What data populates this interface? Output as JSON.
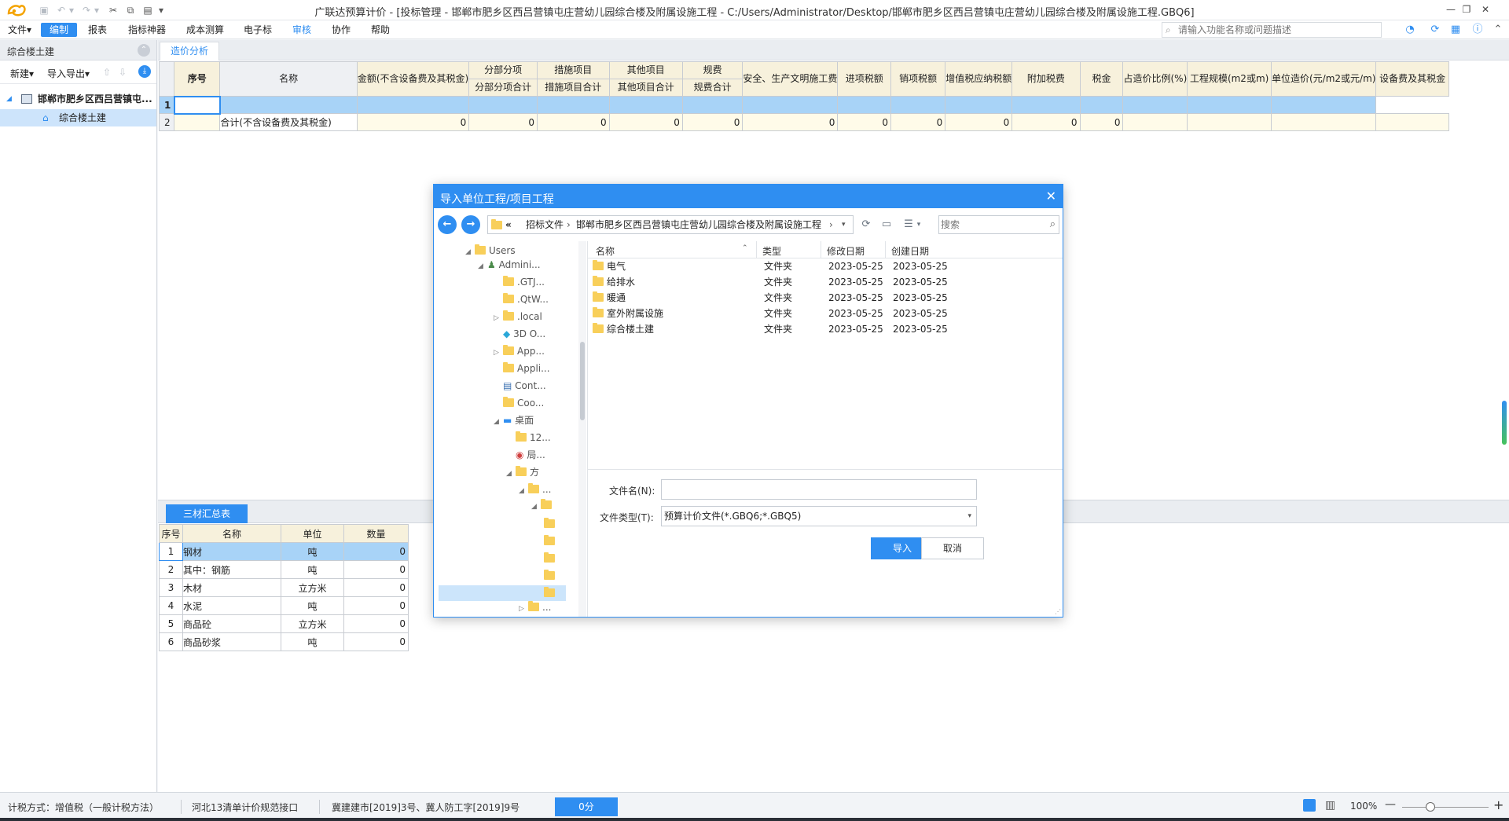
{
  "window": {
    "title": "广联达预算计价 - [投标管理 - 邯郸市肥乡区西吕营镇屯庄营幼儿园综合楼及附属设施工程 - C:/Users/Administrator/Desktop/邯郸市肥乡区西吕营镇屯庄营幼儿园综合楼及附属设施工程.GBQ6]"
  },
  "menu": {
    "items": [
      "文件▾",
      "编制",
      "报表",
      "指标神器",
      "成本测算",
      "电子标",
      "审核",
      "协作",
      "帮助"
    ],
    "search_placeholder": "请输入功能名称或问题描述"
  },
  "left_panel": {
    "title": "综合楼土建",
    "tools": {
      "new": "新建▾",
      "import_export": "导入导出▾"
    },
    "tree": {
      "project": "邯郸市肥乡区西吕营镇屯...",
      "unit": "综合楼土建"
    }
  },
  "main": {
    "tab": "造价分析",
    "grid": {
      "headers": {
        "seq": "序号",
        "name": "名称",
        "amount": "金额(不含设备费及其税金)",
        "fbfx": "分部分项",
        "fbfx_sub": "分部分项合计",
        "csxm": "措施项目",
        "csxm_sub": "措施项目合计",
        "qtxm": "其他项目",
        "qtxm_sub": "其他项目合计",
        "gf": "规费",
        "gf_sub": "规费合计",
        "aqwm": "安全、生产文明施工费",
        "jxse": "进项税额",
        "xxse": "销项税额",
        "zzs": "增值税应纳税额",
        "fjs": "附加税费",
        "sj": "税金",
        "zb": "占造价比例(%)",
        "gcgm": "工程规模(m2或m)",
        "dwzj": "单位造价(元/m2或元/m)",
        "sbf": "设备费及其税金"
      },
      "rows": [
        {
          "no": "1",
          "seq": "",
          "name": "",
          "vals": [
            "",
            "",
            "",
            "",
            "",
            "",
            "",
            "",
            "",
            "",
            "",
            "",
            "",
            "",
            "",
            ""
          ]
        },
        {
          "no": "2",
          "seq": "",
          "name": "合计(不含设备费及其税金)",
          "vals": [
            "0",
            "0",
            "0",
            "0",
            "0",
            "0",
            "0",
            "0",
            "0",
            "0",
            "0",
            "",
            "",
            "",
            ""
          ]
        }
      ]
    }
  },
  "materials": {
    "tab": "三材汇总表",
    "headers": [
      "序号",
      "名称",
      "单位",
      "数量"
    ],
    "rows": [
      {
        "no": "1",
        "name": "钢材",
        "unit": "吨",
        "qty": "0"
      },
      {
        "no": "2",
        "name": "其中：钢筋",
        "unit": "吨",
        "qty": "0"
      },
      {
        "no": "3",
        "name": "木材",
        "unit": "立方米",
        "qty": "0"
      },
      {
        "no": "4",
        "name": "水泥",
        "unit": "吨",
        "qty": "0"
      },
      {
        "no": "5",
        "name": "商品砼",
        "unit": "立方米",
        "qty": "0"
      },
      {
        "no": "6",
        "name": "商品砂浆",
        "unit": "吨",
        "qty": "0"
      }
    ]
  },
  "dialog": {
    "title": "导入单位工程/项目工程",
    "address": {
      "prefix": "«",
      "crumb1": "招标文件",
      "crumb2": "邯郸市肥乡区西吕营镇屯庄营幼儿园综合楼及附属设施工程"
    },
    "search_placeholder": "搜索",
    "tree": [
      {
        "label": "Users"
      },
      {
        "label": "Admini..."
      },
      {
        "label": ".GTJ..."
      },
      {
        "label": ".QtW..."
      },
      {
        "label": ".local"
      },
      {
        "label": "3D O..."
      },
      {
        "label": "App..."
      },
      {
        "label": "Appli..."
      },
      {
        "label": "Cont..."
      },
      {
        "label": "Coo..."
      },
      {
        "label": "桌面"
      },
      {
        "label": "12..."
      },
      {
        "label": "局..."
      },
      {
        "label": "方"
      },
      {
        "label": "..."
      },
      {
        "label": "..."
      }
    ],
    "columns": {
      "name": "名称",
      "type": "类型",
      "modified": "修改日期",
      "created": "创建日期"
    },
    "files": [
      {
        "name": "电气",
        "type": "文件夹",
        "modified": "2023-05-25",
        "created": "2023-05-25"
      },
      {
        "name": "给排水",
        "type": "文件夹",
        "modified": "2023-05-25",
        "created": "2023-05-25"
      },
      {
        "name": "暖通",
        "type": "文件夹",
        "modified": "2023-05-25",
        "created": "2023-05-25"
      },
      {
        "name": "室外附属设施",
        "type": "文件夹",
        "modified": "2023-05-25",
        "created": "2023-05-25"
      },
      {
        "name": "综合楼土建",
        "type": "文件夹",
        "modified": "2023-05-25",
        "created": "2023-05-25"
      }
    ],
    "filename_label": "文件名(N):",
    "filename_value": "",
    "filetype_label": "文件类型(T):",
    "filetype_value": "预算计价文件(*.GBQ6;*.GBQ5)",
    "import_button": "导入",
    "cancel_button": "取消"
  },
  "status": {
    "tax_method": "计税方式：增值税（一般计税方法）",
    "standard": "河北13清单计价规范接口",
    "doc": "冀建建市[2019]3号、冀人防工字[2019]9号",
    "score": "0分",
    "zoom": "100%"
  },
  "colors": {
    "accent": "#2f8ef1",
    "header_bg": "#f7f1dc",
    "selected_row": "#a8d3f7"
  }
}
